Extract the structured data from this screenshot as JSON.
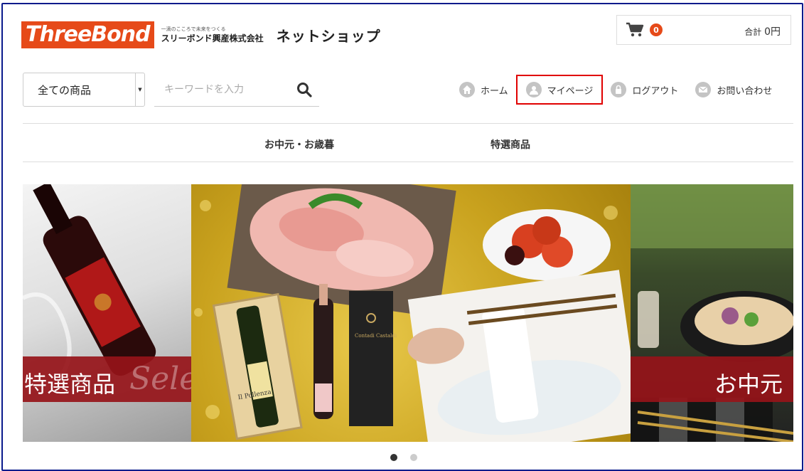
{
  "header": {
    "logo_text": "ThreeBond",
    "company_tagline": "一滴のこころで未来をつくる",
    "company_name": "スリーボンド興産株式会社",
    "shop_name": "ネットショップ"
  },
  "cart": {
    "count": "0",
    "total_label": "合計",
    "total_value": "0円"
  },
  "search": {
    "category_selected": "全ての商品",
    "placeholder": "キーワードを入力"
  },
  "nav": {
    "home": "ホーム",
    "mypage": "マイページ",
    "logout": "ログアウト",
    "contact": "お問い合わせ"
  },
  "categories": [
    "お中元・お歳暮",
    "特選商品"
  ],
  "banner": {
    "left_label": "特選商品",
    "left_script": "Selec",
    "right_label": "お中元",
    "bottle_label_1": "Il Pollenza",
    "box_label": "Contadi Castaldi"
  },
  "carousel": {
    "slides": 2,
    "active": 1
  },
  "colors": {
    "brand": "#e64a19",
    "highlight_border": "#e00000",
    "frame": "#0a1a8c"
  }
}
